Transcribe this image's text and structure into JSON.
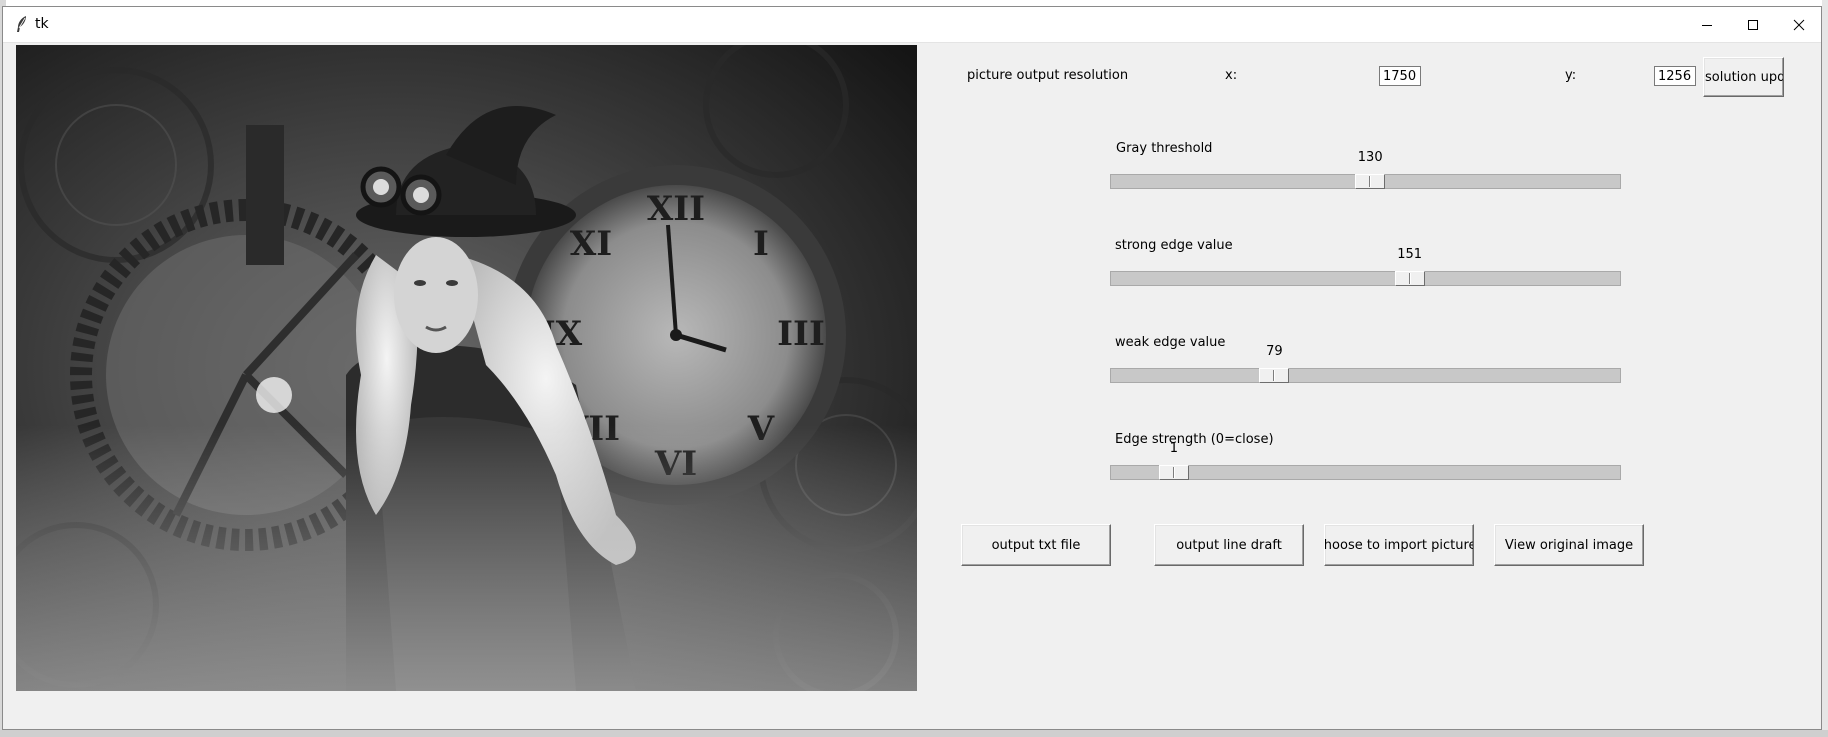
{
  "window": {
    "title": "tk",
    "controls": {
      "minimize_icon": "minimize-icon",
      "maximize_icon": "maximize-icon",
      "close_icon": "close-icon"
    }
  },
  "image_panel": {
    "icon": "grayscale-photo"
  },
  "resolution": {
    "label": "picture output resolution",
    "x_label": "x:",
    "x_value": "1750",
    "y_label": "y:",
    "y_value": "1256",
    "update_button": "solution upda"
  },
  "scales": [
    {
      "label": "Gray threshold",
      "value": "130",
      "min": 0,
      "max": 255
    },
    {
      "label": "strong edge value",
      "value": "151",
      "min": 0,
      "max": 255
    },
    {
      "label": "weak edge value",
      "value": "79",
      "min": 0,
      "max": 255
    },
    {
      "label": "Edge strength (0=close)",
      "value": "1",
      "min": 0,
      "max": 10
    }
  ],
  "buttons": {
    "output_txt": "output txt file",
    "output_line": "output line draft",
    "import": "Choose to import pictures",
    "view_original": "View original image"
  },
  "colors": {
    "window_bg": "#f0f0f0",
    "trough": "#c8c8c8"
  }
}
